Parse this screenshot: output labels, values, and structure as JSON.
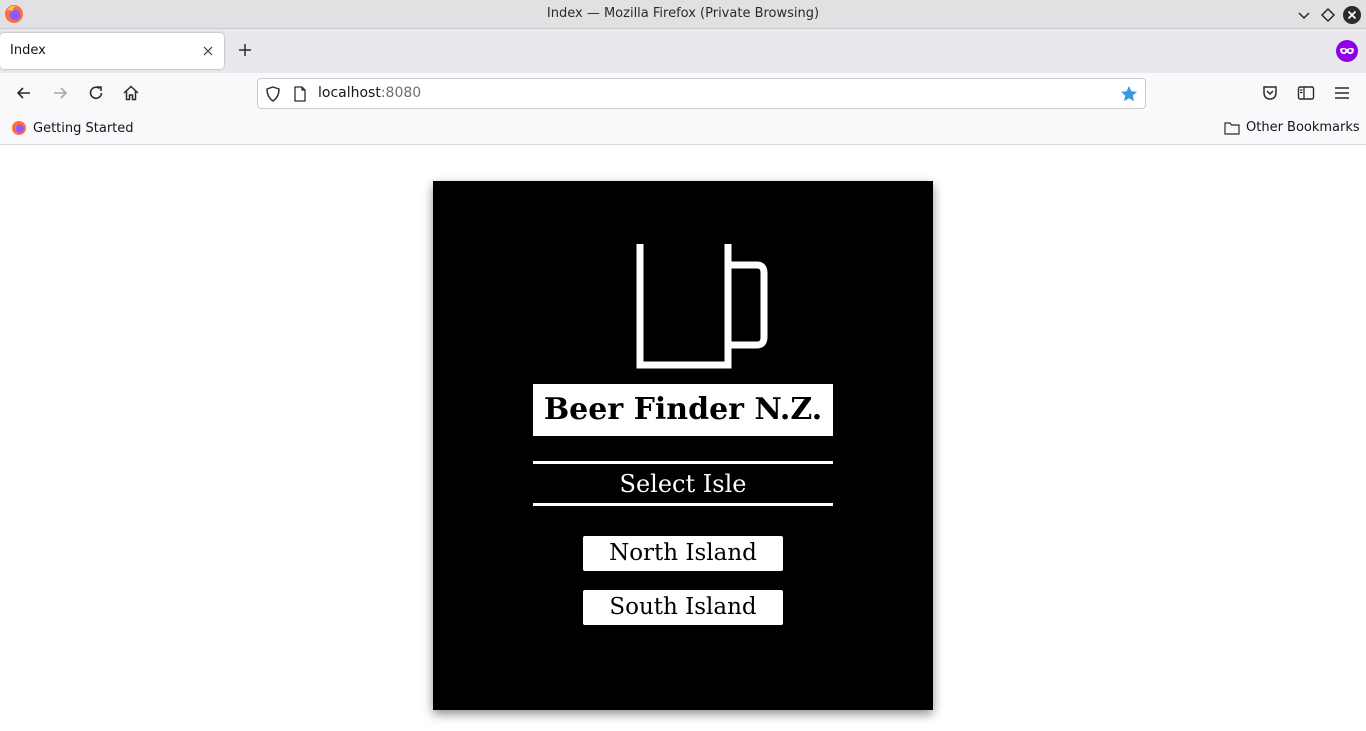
{
  "window": {
    "title": "Index — Mozilla Firefox (Private Browsing)"
  },
  "tabs": [
    {
      "label": "Index",
      "active": true
    }
  ],
  "urlbar": {
    "host": "localhost",
    "port": ":8080"
  },
  "bookmarks": {
    "items": [
      {
        "label": "Getting Started"
      }
    ],
    "other_label": "Other Bookmarks"
  },
  "page": {
    "title": "Beer Finder N.Z.",
    "select_label": "Select Isle",
    "buttons": [
      {
        "label": "North Island"
      },
      {
        "label": "South Island"
      }
    ]
  },
  "colors": {
    "accent_star": "#3b9ae1",
    "card": "#000000",
    "private": "#8f00e8"
  }
}
